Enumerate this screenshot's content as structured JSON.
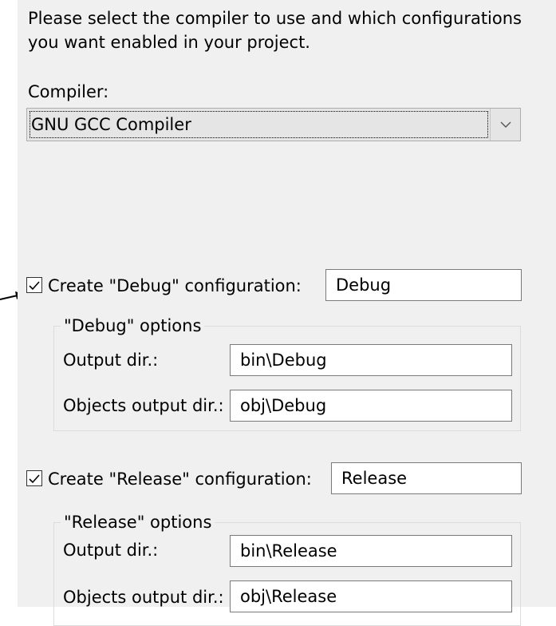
{
  "intro_text": "Please select the compiler to use and which configurations you want enabled in your project.",
  "compiler": {
    "label": "Compiler:",
    "selected": "GNU GCC Compiler"
  },
  "debug": {
    "checkbox_label": "Create \"Debug\" configuration:",
    "checked": true,
    "name_value": "Debug",
    "group_label": "\"Debug\" options",
    "output_dir_label": "Output dir.:",
    "output_dir_value": "bin\\Debug",
    "objects_dir_label": "Objects output dir.:",
    "objects_dir_value": "obj\\Debug"
  },
  "release": {
    "checkbox_label": "Create \"Release\" configuration:",
    "checked": true,
    "name_value": "Release",
    "group_label": "\"Release\" options",
    "output_dir_label": "Output dir.:",
    "output_dir_value": "bin\\Release",
    "objects_dir_label": "Objects output dir.:",
    "objects_dir_value": "obj\\Release"
  },
  "icons": {
    "annotation_arrow": "arrow-right-icon",
    "dropdown": "chevron-down-icon",
    "checkmark": "checkmark-icon"
  }
}
